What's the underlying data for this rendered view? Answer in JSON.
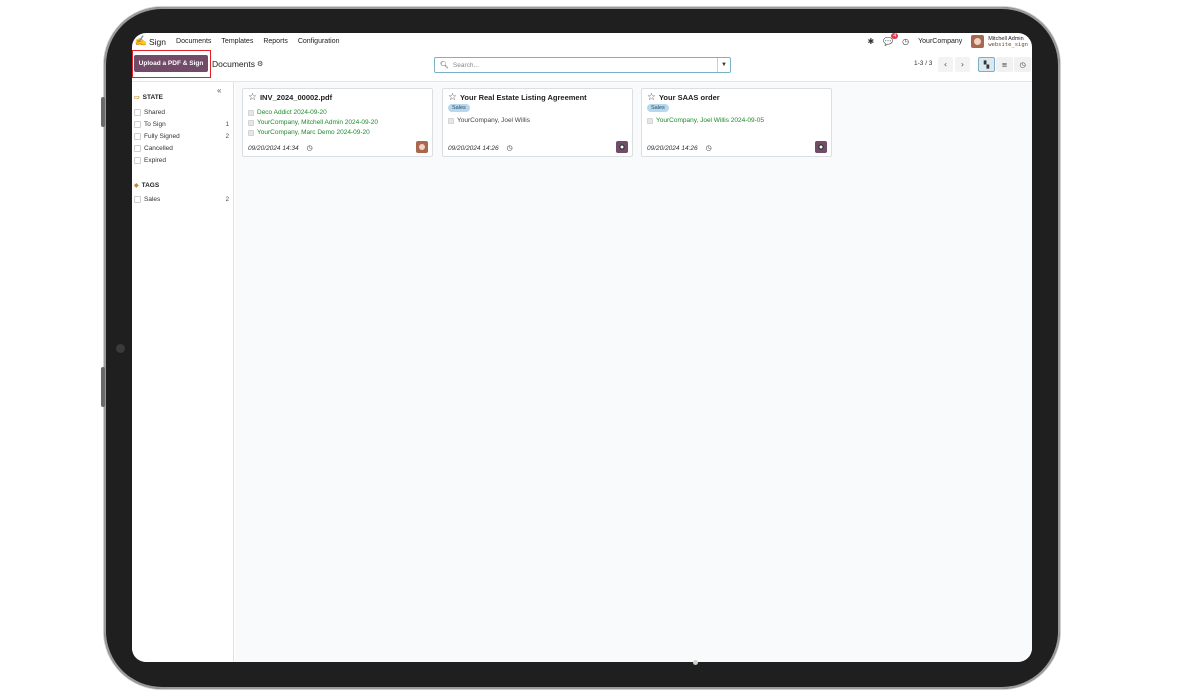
{
  "navbar": {
    "app_name": "Sign",
    "menu": [
      "Documents",
      "Templates",
      "Reports",
      "Configuration"
    ],
    "messages_badge": "4",
    "company": "YourCompany",
    "user_name": "Mitchell Admin",
    "database": "website_sign",
    "icons": [
      "sign-logo-icon",
      "bug-icon",
      "chat-icon",
      "clock-icon"
    ]
  },
  "control_panel": {
    "upload_label": "Upload a PDF & Sign",
    "breadcrumb": "Documents",
    "search_placeholder": "Search...",
    "pager": "1-3 / 3",
    "views": [
      "kanban",
      "list",
      "activity"
    ],
    "active_view": "kanban"
  },
  "sidebar": {
    "state_title": "STATE",
    "state_items": [
      {
        "label": "Shared",
        "count": ""
      },
      {
        "label": "To Sign",
        "count": "1"
      },
      {
        "label": "Fully Signed",
        "count": "2"
      },
      {
        "label": "Cancelled",
        "count": ""
      },
      {
        "label": "Expired",
        "count": ""
      }
    ],
    "tags_title": "TAGS",
    "tag_items": [
      {
        "label": "Sales",
        "count": "2"
      }
    ]
  },
  "cards": [
    {
      "title": "INV_2024_00002.pdf",
      "tag": "",
      "signers": [
        {
          "text": "Deco Addict 2024-09-20",
          "status": "done"
        },
        {
          "text": "YourCompany, Mitchell Admin 2024-09-20",
          "status": "done"
        },
        {
          "text": "YourCompany, Marc Demo 2024-09-20",
          "status": "done"
        }
      ],
      "date": "09/20/2024 14:34"
    },
    {
      "title": "Your Real Estate Listing Agreement",
      "tag": "Sales",
      "signers": [
        {
          "text": "YourCompany, Joel Willis",
          "status": "pending"
        }
      ],
      "date": "09/20/2024 14:26"
    },
    {
      "title": "Your SAAS order",
      "tag": "Sales",
      "signers": [
        {
          "text": "YourCompany, Joel Willis 2024-09-05",
          "status": "done"
        }
      ],
      "date": "09/20/2024 14:26"
    }
  ],
  "colors": {
    "brand": "#714b67",
    "signed_green": "#1d8a2a",
    "tag_blue": "#b7d7ec",
    "highlight_red": "#e0202a"
  }
}
